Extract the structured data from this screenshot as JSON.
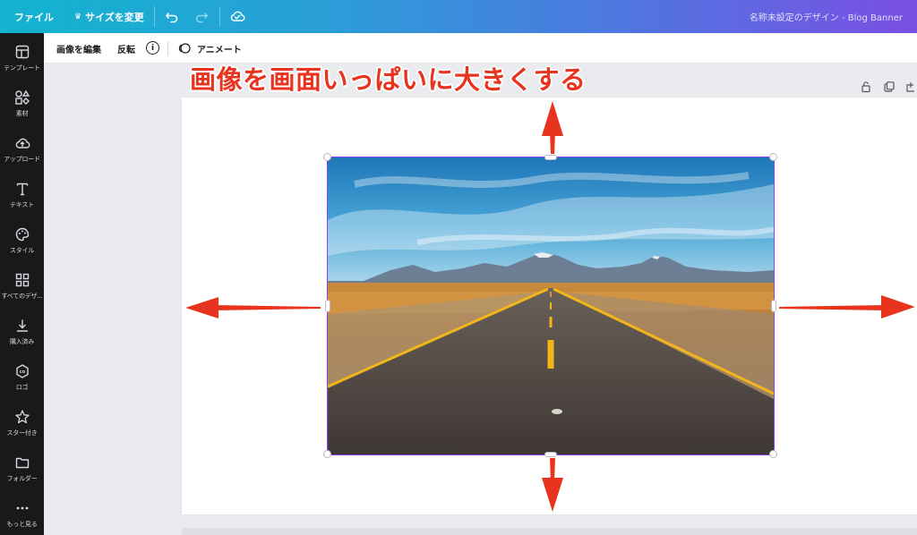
{
  "topbar": {
    "file_label": "ファイル",
    "resize_label": "サイズを変更",
    "document_title": "名称未設定のデザイン - Blog Banner",
    "gradient_start": "#12b4cf",
    "gradient_end": "#7a4fe3"
  },
  "sidebar": {
    "items": [
      {
        "label": "テンプレート",
        "icon": "template-icon"
      },
      {
        "label": "素材",
        "icon": "elements-icon"
      },
      {
        "label": "アップロード",
        "icon": "upload-icon"
      },
      {
        "label": "テキスト",
        "icon": "text-icon"
      },
      {
        "label": "スタイル",
        "icon": "palette-icon"
      },
      {
        "label": "すべてのデザ...",
        "icon": "grid-icon"
      },
      {
        "label": "購入済み",
        "icon": "download-icon"
      },
      {
        "label": "ロゴ",
        "icon": "logo-icon"
      },
      {
        "label": "スター付き",
        "icon": "star-icon"
      },
      {
        "label": "フォルダー",
        "icon": "folder-icon"
      },
      {
        "label": "もっと見る",
        "icon": "more-icon"
      }
    ]
  },
  "context_toolbar": {
    "edit_image": "画像を編集",
    "flip": "反転",
    "info": "i",
    "animate": "アニメート"
  },
  "annotation": {
    "headline": "画像を画面いっぱいに大きくする",
    "arrow_color": "#e8341e"
  },
  "selection_color": "#8b3dff"
}
